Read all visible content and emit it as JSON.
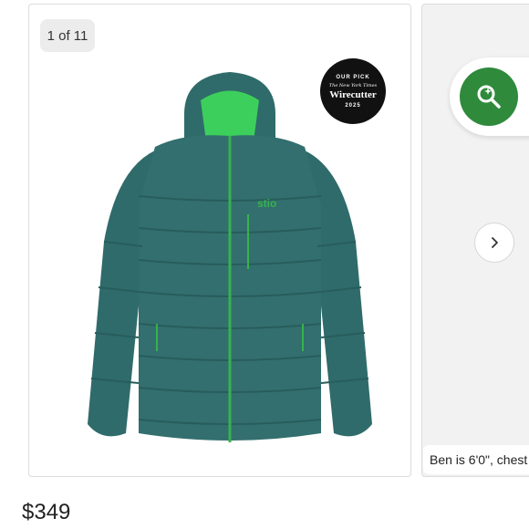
{
  "gallery": {
    "counter": "1 of 11",
    "badge": {
      "top_text": "OUR PICK",
      "publisher": "The New York Times",
      "brand": "Wirecutter",
      "year": "2025"
    },
    "second_image_caption": "Ben is 6'0\", chest",
    "zoom_icon": "zoom-in-icon",
    "next_icon": "chevron-right-icon"
  },
  "product": {
    "price": "$349",
    "logo_text": "stio"
  },
  "colors": {
    "jacket_body": "#2f6b6a",
    "jacket_accent": "#37b24d",
    "zoom_button": "#2f8a3c",
    "badge_bg": "#111111"
  }
}
